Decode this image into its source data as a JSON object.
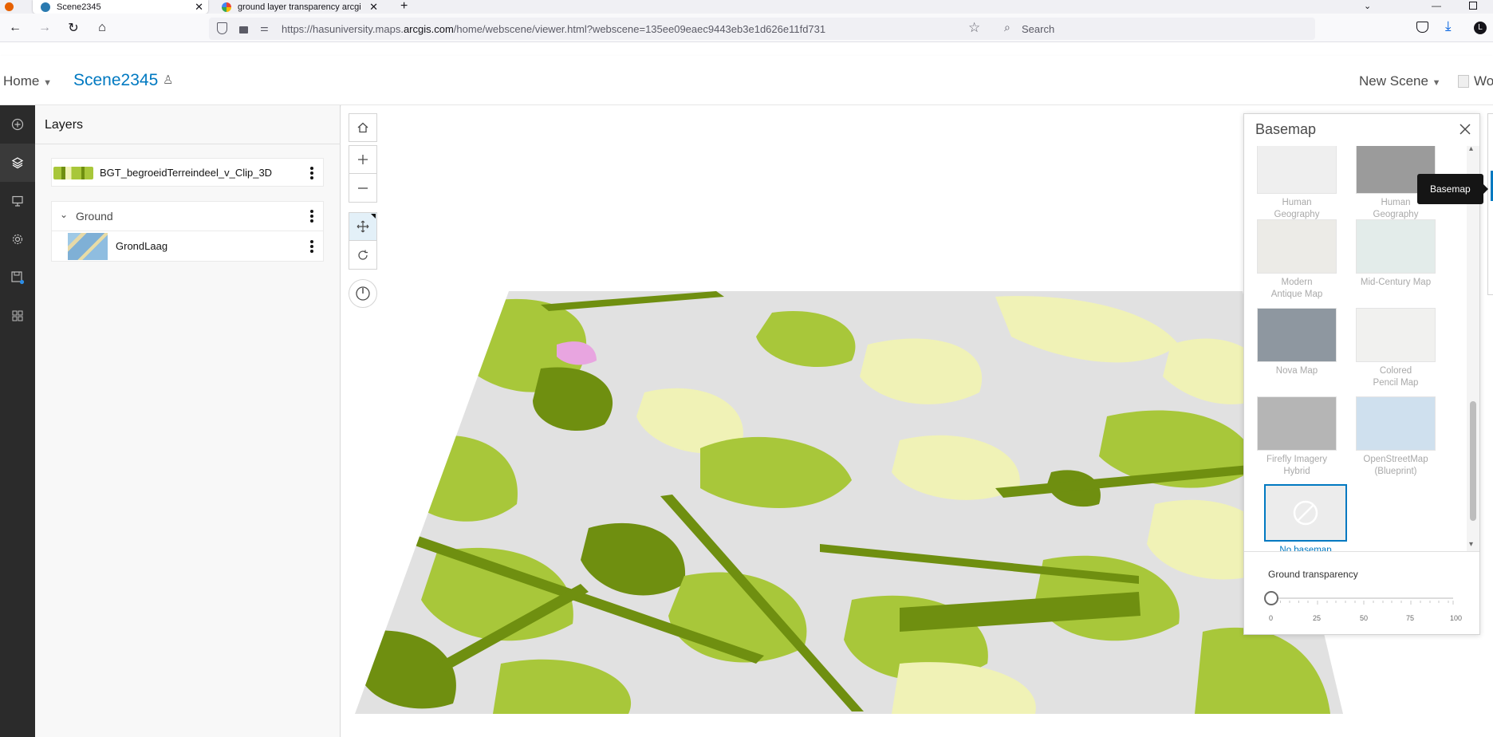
{
  "browser": {
    "tabs": [
      {
        "title": "Scene2345",
        "active": true
      },
      {
        "title": "ground layer transparency arcgi",
        "active": false
      }
    ],
    "url_prefix": "https://hasuniversity.maps.",
    "url_domain": "arcgis.com",
    "url_suffix": "/home/webscene/viewer.html?webscene=135ee09eaec9443eb3e1d626e11fd731",
    "search_placeholder": "Search"
  },
  "header": {
    "home_label": "Home",
    "scene_title": "Scene2345",
    "new_scene_label": "New Scene",
    "user_label": "Wo"
  },
  "layers": {
    "title": "Layers",
    "items": [
      {
        "name": "BGT_begroeidTerreindeel_v_Clip_3D"
      }
    ],
    "ground": {
      "label": "Ground",
      "children": [
        {
          "name": "GrondLaag"
        }
      ]
    }
  },
  "basemap": {
    "title": "Basemap",
    "items": [
      {
        "label": "Human Geography Map",
        "icon": "human-geography-thumb"
      },
      {
        "label": "Human Geography Dark",
        "icon": "human-geography-dark-thumb"
      },
      {
        "label": "Modern Antique Map",
        "icon": "modern-antique-thumb"
      },
      {
        "label": "Mid-Century Map",
        "icon": "mid-century-thumb"
      },
      {
        "label": "Nova Map",
        "icon": "nova-thumb"
      },
      {
        "label": "Colored Pencil Map",
        "icon": "colored-pencil-thumb"
      },
      {
        "label": "Firefly Imagery Hybrid",
        "icon": "firefly-thumb"
      },
      {
        "label": "OpenStreetMap (Blueprint)",
        "icon": "osm-blueprint-thumb"
      },
      {
        "label": "No basemap",
        "icon": "no-basemap-icon",
        "selected": true
      }
    ],
    "transparency": {
      "label": "Ground transparency",
      "value": 0,
      "tick_labels": [
        "0",
        "25",
        "50",
        "75",
        "100"
      ]
    },
    "tooltip": "Basemap"
  },
  "colors": {
    "accent": "#0079c1",
    "veg_dark": "#6f8f10",
    "veg_mid": "#a8c73a",
    "veg_light": "#f0f2b6",
    "ground": "#e1e1e1"
  }
}
